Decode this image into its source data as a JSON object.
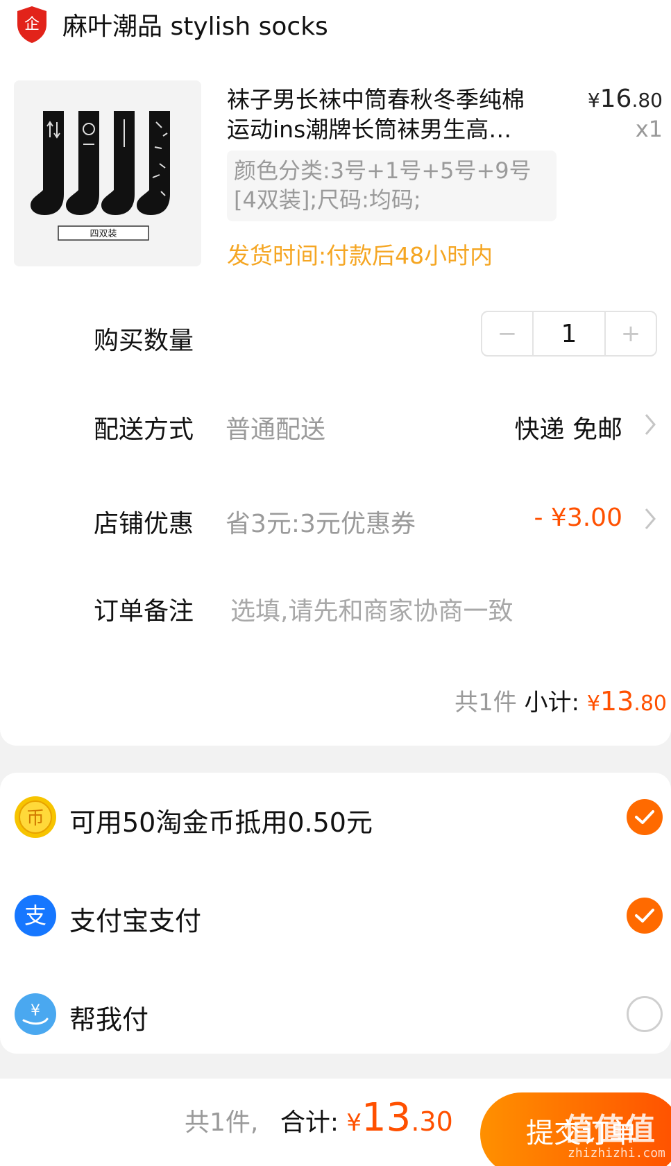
{
  "shop": {
    "name": "麻叶潮品 stylish socks",
    "badge_icon": "shop-shield-icon",
    "badge_char": "企"
  },
  "product": {
    "title_line1": "袜子男长袜中筒春秋冬季纯棉",
    "title_line2": "运动ins潮牌长筒袜男生高…",
    "price_symbol": "¥",
    "price_int": "16",
    "price_dec": ".80",
    "qty_label": "x1",
    "sku_line1": "颜色分类:3号+1号+5号+9号",
    "sku_line2": "[4双装];尺码:均码;",
    "ship_time": "发货时间:付款后48小时内",
    "image_caption": "四双装"
  },
  "quantity": {
    "label": "购买数量",
    "value": "1",
    "minus": "−",
    "plus": "+"
  },
  "delivery": {
    "label": "配送方式",
    "sub": "普通配送",
    "value": "快递 免邮"
  },
  "shop_discount": {
    "label": "店铺优惠",
    "sub": "省3元:3元优惠券",
    "value": "- ¥3.00"
  },
  "note": {
    "label": "订单备注",
    "placeholder": "选填,请先和商家协商一致"
  },
  "subtotal": {
    "count": "共1件",
    "label": "小计:",
    "symbol": "¥",
    "int": "13",
    "dec": ".80"
  },
  "payment": [
    {
      "label": "可用50淘金币抵用0.50元",
      "icon": "taojinbi-coin-icon",
      "checked": true
    },
    {
      "label": "支付宝支付",
      "icon": "alipay-icon",
      "checked": true
    },
    {
      "label": "帮我付",
      "icon": "help-me-pay-icon",
      "checked": false
    }
  ],
  "footer": {
    "count": "共1件,",
    "label": "合计:",
    "symbol": "¥",
    "int": "13",
    "dec": ".30",
    "submit": "提交订单",
    "watermark": "值值值",
    "watermark_url": "zhizhizhi.com"
  },
  "colors": {
    "accent": "#ff5000",
    "warning": "#f5a623",
    "alipay": "#1677ff",
    "muted": "#9a9a9a"
  }
}
